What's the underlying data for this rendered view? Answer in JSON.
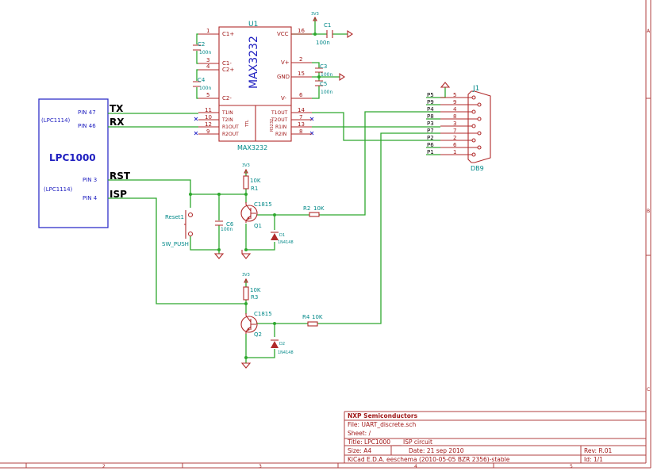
{
  "mcu": {
    "name": "LPC1000",
    "variant1": "(LPC1114)",
    "variant2": "(LPC1114)",
    "pins": [
      "PIN 47",
      "PIN 46",
      "PIN 3",
      "PIN 4"
    ],
    "nets": [
      "TX",
      "RX",
      "RST",
      "ISP"
    ]
  },
  "u1": {
    "ref": "U1",
    "value": "MAX3232",
    "body_label": "MAX3232",
    "sub_left": "TTL",
    "sub_right": "RS232",
    "left_pins": [
      {
        "num": "1",
        "name": "C1+"
      },
      {
        "num": "3",
        "name": "C1-"
      },
      {
        "num": "4",
        "name": "C2+"
      },
      {
        "num": "5",
        "name": "C2-"
      },
      {
        "num": "11",
        "name": "T1IN"
      },
      {
        "num": "10",
        "name": "T2IN"
      },
      {
        "num": "12",
        "name": "R1OUT"
      },
      {
        "num": "9",
        "name": "R2OUT"
      }
    ],
    "right_pins": [
      {
        "num": "16",
        "name": "VCC"
      },
      {
        "num": "2",
        "name": "V+"
      },
      {
        "num": "15",
        "name": "GND"
      },
      {
        "num": "6",
        "name": "V-"
      },
      {
        "num": "14",
        "name": "T1OUT"
      },
      {
        "num": "7",
        "name": "T2OUT"
      },
      {
        "num": "13",
        "name": "R1IN"
      },
      {
        "num": "8",
        "name": "R2IN"
      }
    ]
  },
  "caps": [
    {
      "ref": "C1",
      "value": "100n"
    },
    {
      "ref": "C2",
      "value": "100n"
    },
    {
      "ref": "C3",
      "value": "100n"
    },
    {
      "ref": "C4",
      "value": "100n"
    },
    {
      "ref": "C5",
      "value": "100n"
    },
    {
      "ref": "C6",
      "value": "100n"
    }
  ],
  "power": "3V3",
  "resistors": [
    {
      "ref": "R1",
      "value": "10K"
    },
    {
      "ref": "R2",
      "value": "10K"
    },
    {
      "ref": "R3",
      "value": "10K"
    },
    {
      "ref": "R4",
      "value": "10K"
    }
  ],
  "transistors": [
    {
      "ref": "Q1",
      "value": "C1815"
    },
    {
      "ref": "Q2",
      "value": "C1815"
    }
  ],
  "diodes": [
    {
      "ref": "D1",
      "value": "1N4148"
    },
    {
      "ref": "D2",
      "value": "1N4148"
    }
  ],
  "switch": {
    "ref": "Reset1",
    "value": "SW_PUSH"
  },
  "connector": {
    "ref": "J1",
    "value": "DB9",
    "pins": [
      {
        "label": "P5",
        "num": "5"
      },
      {
        "label": "P9",
        "num": "9"
      },
      {
        "label": "P4",
        "num": "4"
      },
      {
        "label": "P8",
        "num": "8"
      },
      {
        "label": "P3",
        "num": "3"
      },
      {
        "label": "P7",
        "num": "7"
      },
      {
        "label": "P2",
        "num": "2"
      },
      {
        "label": "P6",
        "num": "6"
      },
      {
        "label": "P1",
        "num": "1"
      }
    ]
  },
  "title_block": {
    "company": "NXP Semiconductors",
    "file": "File: UART_discrete.sch",
    "sheet": "Sheet: /",
    "title": "Title: LPC1000 ___ ISP circuit",
    "size": "Size: A4",
    "date": "Date: 21 sep 2010",
    "rev": "Rev: R.01",
    "tool": "KiCad E.D.A.  eeschema (2010-05-05 BZR 2356)-stable",
    "id": "Id: 1/1"
  },
  "border": {
    "columns": [
      "2",
      "3",
      "4",
      "5"
    ],
    "rows": [
      "A",
      "B",
      "C"
    ]
  },
  "colors": {
    "wire": "#2ea82e",
    "component": "#b02a2a",
    "text": "#008888",
    "mcu": "#3030c8"
  }
}
